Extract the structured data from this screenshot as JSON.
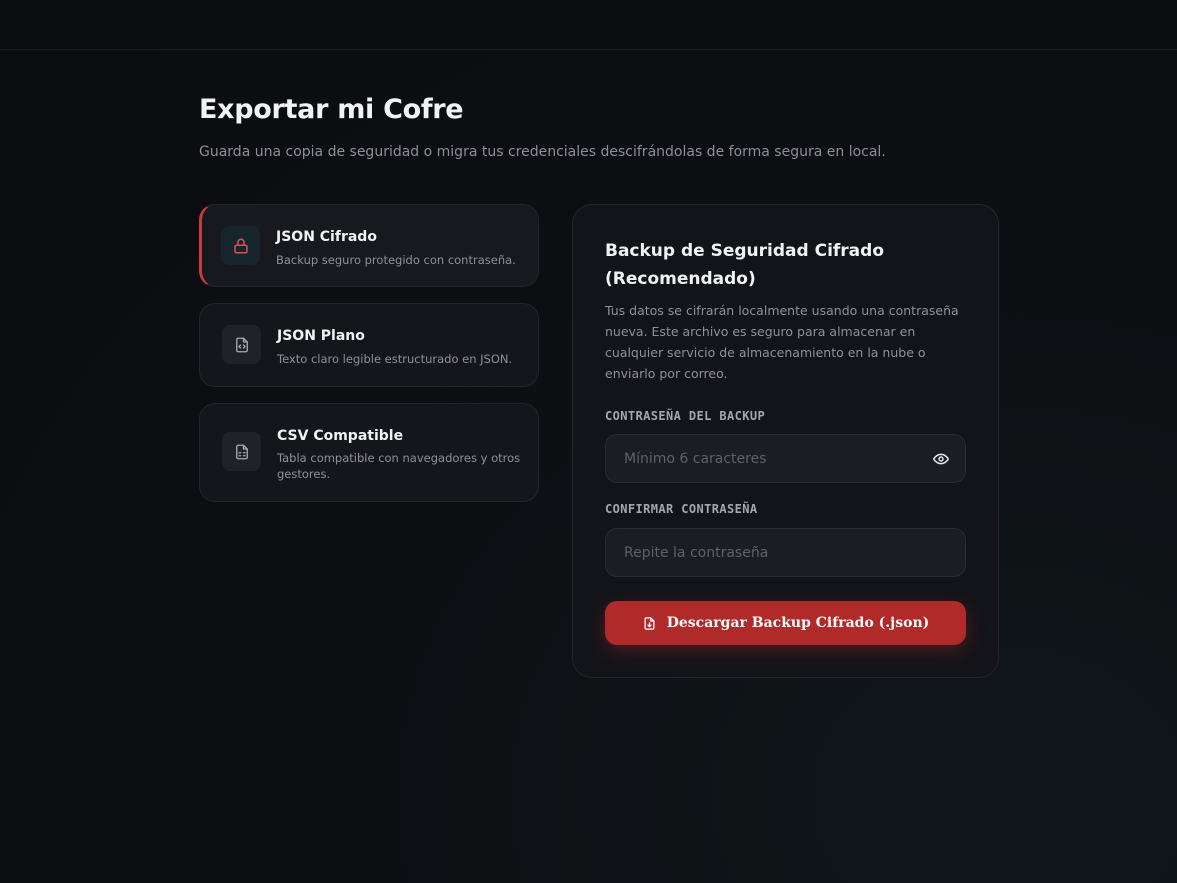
{
  "header": {
    "title": "Exportar mi Cofre",
    "subtitle": "Guarda una copia de seguridad o migra tus credenciales descifrándolas de forma segura en local."
  },
  "options": [
    {
      "title": "JSON Cifrado",
      "description": "Backup seguro protegido con contraseña.",
      "icon": "lock-icon",
      "active": true
    },
    {
      "title": "JSON Plano",
      "description": "Texto claro legible estructurado en JSON.",
      "icon": "file-code-icon",
      "active": false
    },
    {
      "title": "CSV Compatible",
      "description": "Tabla compatible con navegadores y otros gestores.",
      "icon": "file-spreadsheet-icon",
      "active": false
    }
  ],
  "panel": {
    "title": "Backup de Seguridad Cifrado (Recomendado)",
    "description": "Tus datos se cifrarán localmente usando una contraseña nueva. Este archivo es seguro para almacenar en cualquier servicio de almacenamiento en la nube o enviarlo por correo.",
    "password_label": "CONTRASEÑA DEL BACKUP",
    "password_placeholder": "Mínimo 6 caracteres",
    "password_value": "",
    "confirm_label": "CONFIRMAR CONTRASEÑA",
    "confirm_placeholder": "Repite la contraseña",
    "confirm_value": "",
    "download_label": "Descargar Backup Cifrado (.json)"
  },
  "colors": {
    "accent": "#b02a2a",
    "active_border": "#c73b3b",
    "background": "#0d0f13",
    "card": "#15161b"
  }
}
